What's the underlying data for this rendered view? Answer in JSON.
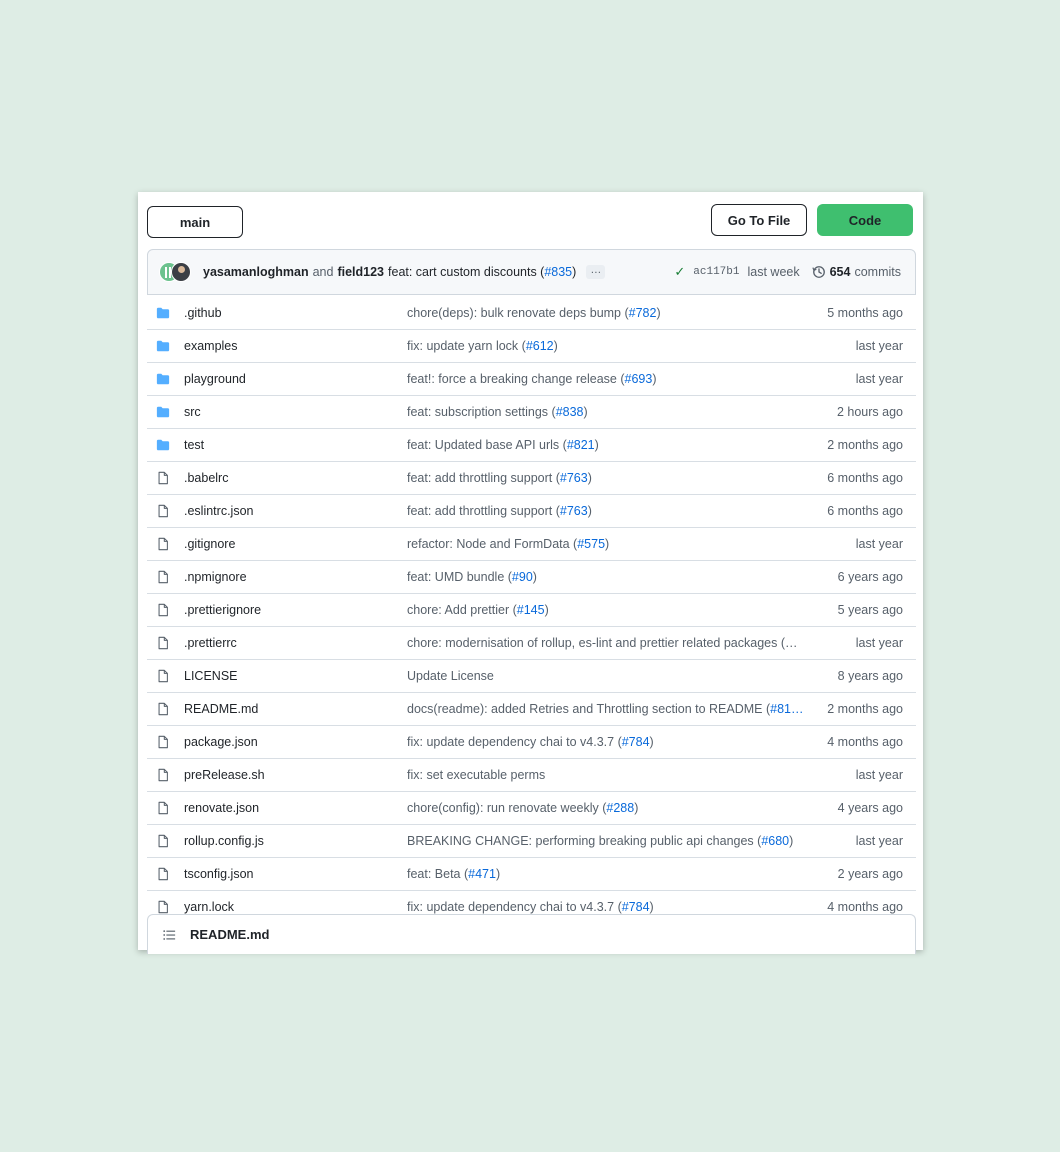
{
  "toolbar": {
    "branch": "main",
    "goto_file": "Go To File",
    "code": "Code"
  },
  "commit": {
    "author1": "yasamanloghman",
    "and": "and",
    "author2": "field123",
    "message_prefix": "feat: cart custom discounts (",
    "pr": "#835",
    "message_suffix": ")",
    "ellipsis": "…",
    "sha": "ac117b1",
    "time": "last week",
    "count": "654",
    "commits_label": "commits"
  },
  "files": [
    {
      "name": ".github",
      "type": "dir",
      "msg": "chore(deps): bulk renovate deps bump (",
      "pr": "#782",
      "suffix": ")",
      "time": "5 months ago"
    },
    {
      "name": "examples",
      "type": "dir",
      "msg": "fix: update yarn lock (",
      "pr": "#612",
      "suffix": ")",
      "time": "last year"
    },
    {
      "name": "playground",
      "type": "dir",
      "msg": "feat!: force a breaking change release (",
      "pr": "#693",
      "suffix": ")",
      "time": "last year"
    },
    {
      "name": "src",
      "type": "dir",
      "msg": "feat: subscription settings (",
      "pr": "#838",
      "suffix": ")",
      "time": "2 hours ago"
    },
    {
      "name": "test",
      "type": "dir",
      "msg": "feat: Updated base API urls (",
      "pr": "#821",
      "suffix": ")",
      "time": "2 months ago"
    },
    {
      "name": ".babelrc",
      "type": "file",
      "msg": "feat: add throttling support (",
      "pr": "#763",
      "suffix": ")",
      "time": "6 months ago"
    },
    {
      "name": ".eslintrc.json",
      "type": "file",
      "msg": "feat: add throttling support (",
      "pr": "#763",
      "suffix": ")",
      "time": "6 months ago"
    },
    {
      "name": ".gitignore",
      "type": "file",
      "msg": "refactor: Node and FormData (",
      "pr": "#575",
      "suffix": ")",
      "time": "last year"
    },
    {
      "name": ".npmignore",
      "type": "file",
      "msg": "feat: UMD bundle (",
      "pr": "#90",
      "suffix": ")",
      "time": "6 years ago"
    },
    {
      "name": ".prettierignore",
      "type": "file",
      "msg": "chore: Add prettier (",
      "pr": "#145",
      "suffix": ")",
      "time": "5 years ago"
    },
    {
      "name": ".prettierrc",
      "type": "file",
      "msg": "chore: modernisation of rollup, es-lint and prettier related packages (…",
      "pr": "",
      "suffix": "",
      "time": "last year"
    },
    {
      "name": "LICENSE",
      "type": "file",
      "msg": "Update License",
      "pr": "",
      "suffix": "",
      "time": "8 years ago"
    },
    {
      "name": "README.md",
      "type": "file",
      "msg": "docs(readme): added Retries and Throttling section to README (",
      "pr": "#81…",
      "suffix": "",
      "time": "2 months ago"
    },
    {
      "name": "package.json",
      "type": "file",
      "msg": "fix: update dependency chai to v4.3.7 (",
      "pr": "#784",
      "suffix": ")",
      "time": "4 months ago"
    },
    {
      "name": "preRelease.sh",
      "type": "file",
      "msg": "fix: set executable perms",
      "pr": "",
      "suffix": "",
      "time": "last year"
    },
    {
      "name": "renovate.json",
      "type": "file",
      "msg": "chore(config): run renovate weekly (",
      "pr": "#288",
      "suffix": ")",
      "time": "4 years ago"
    },
    {
      "name": "rollup.config.js",
      "type": "file",
      "msg": "BREAKING CHANGE: performing breaking public api changes (",
      "pr": "#680",
      "suffix": ")",
      "time": "last year"
    },
    {
      "name": "tsconfig.json",
      "type": "file",
      "msg": "feat: Beta (",
      "pr": "#471",
      "suffix": ")",
      "time": "2 years ago"
    },
    {
      "name": "yarn.lock",
      "type": "file",
      "msg": "fix: update dependency chai to v4.3.7 (",
      "pr": "#784",
      "suffix": ")",
      "time": "4 months ago"
    }
  ],
  "readme": {
    "title": "README.md"
  },
  "colors": {
    "background": "#deede5",
    "code_button": "#3fbf6f",
    "link": "#0969da",
    "folder_icon": "#54aeff"
  }
}
